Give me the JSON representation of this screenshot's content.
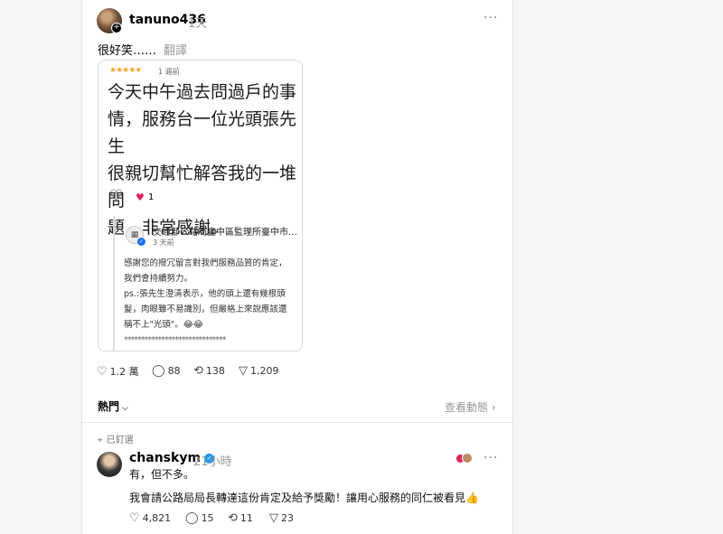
{
  "post": {
    "username": "tanuno436",
    "time": "1天",
    "more": "···",
    "text": "很好笑……",
    "translate": "翻譯",
    "embed": {
      "stars": "★★★★★",
      "review_age": "1 週前",
      "review_lines": [
        "今天中午過去問過戶的事",
        "情，服務台一位光頭張先生",
        "很親切幫忙解答我的一堆問",
        "題，非常感謝。"
      ],
      "heart_count": "1",
      "biz_name": "交通部公路局臺中區監理所臺中市監...",
      "biz_age": "3 天前",
      "reply_lines": [
        "感謝您的撥冗留言對我們服務品質的肯定，",
        "我們會持續努力。",
        "ps.:張先生澄清表示，他的頭上還有幾根頭",
        "髮，肉眼雖不易識別，但嚴格上來說應該還",
        "稱不上\"光頭\"。😂😂",
        "******************************"
      ]
    },
    "actions": {
      "likes": "1.2 萬",
      "comments": "88",
      "reposts": "138",
      "shares": "1,209"
    }
  },
  "sort": {
    "label": "熱門",
    "view_activity": "查看動態"
  },
  "reply": {
    "pinned_label": "已釘選",
    "username": "chanskym",
    "time": "21小時",
    "more": "···",
    "line1": "有，但不多。",
    "line2": "我會請公路局局長轉達這份肯定及給予獎勵！讓用心服務的同仁被看見👍",
    "actions": {
      "likes": "4,821",
      "comments": "15",
      "reposts": "11",
      "shares": "23"
    }
  },
  "colors": {
    "star": "#f5a623",
    "verified": "#1d9bf0",
    "heart": "#e0245e"
  }
}
